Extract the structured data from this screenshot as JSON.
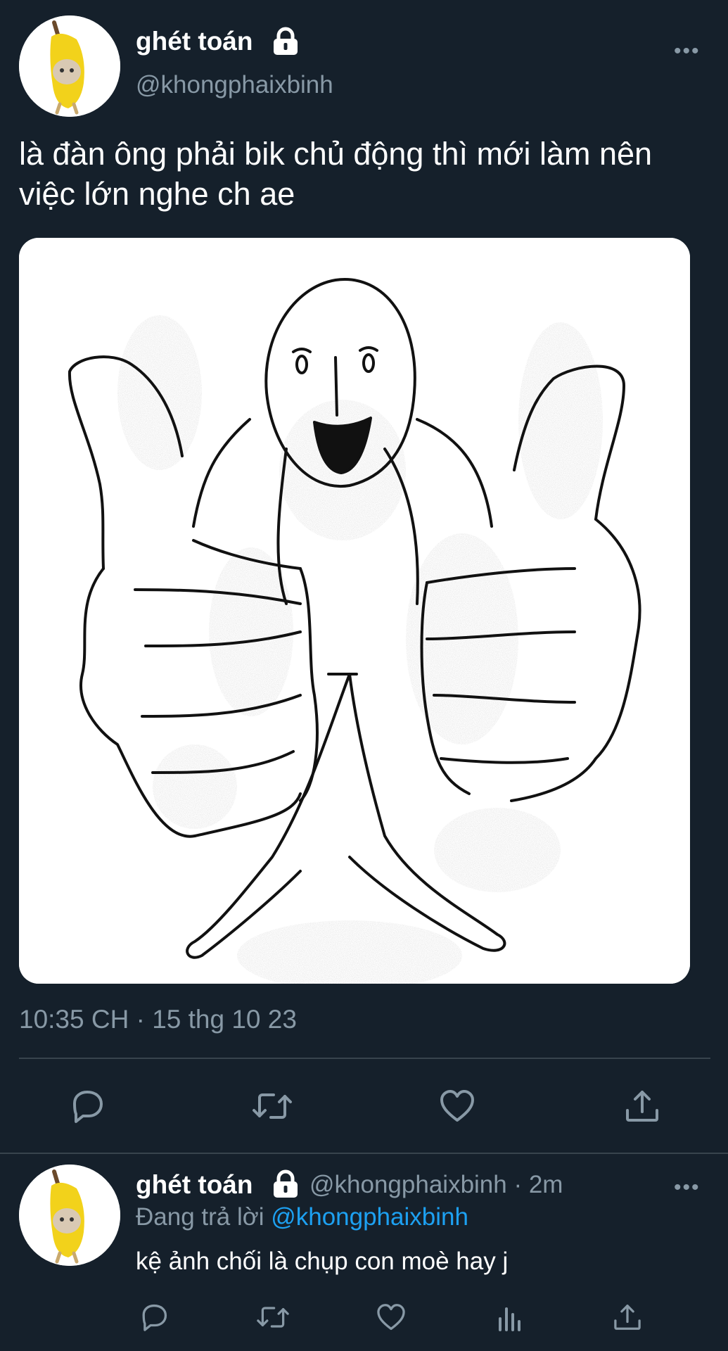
{
  "tweet": {
    "display_name": "ghét toán",
    "handle": "@khongphaixbinh",
    "more": "•••",
    "text": "là đàn ông phải bik chủ động thì mới làm nên việc lớn nghe ch ae",
    "timestamp": "10:35 CH · 15 thg 10 23",
    "icons": [
      "lock-icon",
      "reply-icon",
      "retweet-icon",
      "like-icon",
      "share-icon"
    ]
  },
  "reply": {
    "display_name": "ghét toán",
    "handle_time": "@khongphaixbinh · 2m",
    "replying_to_label": "Đang trả lời",
    "replying_to_handle": "@khongphaixbinh",
    "more": "•••",
    "text": "kệ ảnh chối là chụp con moè hay j",
    "icons": [
      "reply-icon",
      "retweet-icon",
      "like-icon",
      "analytics-icon",
      "share-icon"
    ]
  },
  "colors": {
    "background": "#15202b",
    "secondary_text": "#8899a6",
    "link": "#1da1f2",
    "divider": "#38444d"
  }
}
